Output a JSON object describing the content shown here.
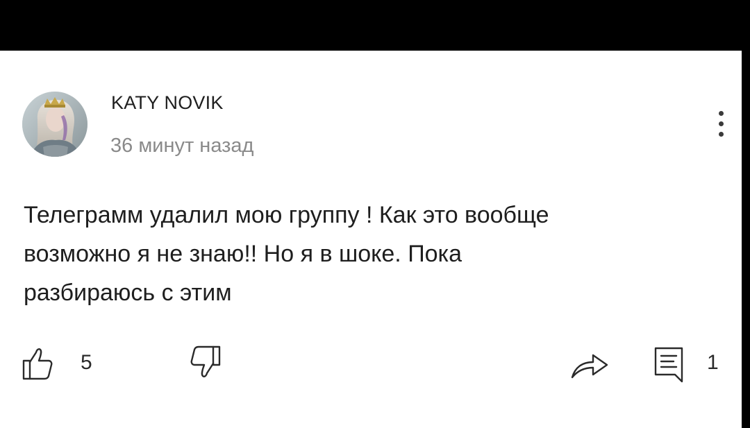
{
  "comment": {
    "author": "KATY NOVIK",
    "timestamp": "36 минут назад",
    "text_lines": [
      "Телеграмм удалил мою группу ! Как это вообще",
      "возможно я не знаю!! Но я в шоке. Пока",
      "разбираюсь с этим"
    ]
  },
  "actions": {
    "like_count": "5",
    "reply_count": "1",
    "icons": {
      "like": "thumbs-up-icon",
      "dislike": "thumbs-down-icon",
      "share": "share-icon",
      "reply": "comment-icon",
      "more": "more-vert-icon"
    }
  },
  "colors": {
    "background": "#ffffff",
    "frame": "#000000",
    "text": "#1e1e1e",
    "secondary_text": "#8a8a8a"
  }
}
